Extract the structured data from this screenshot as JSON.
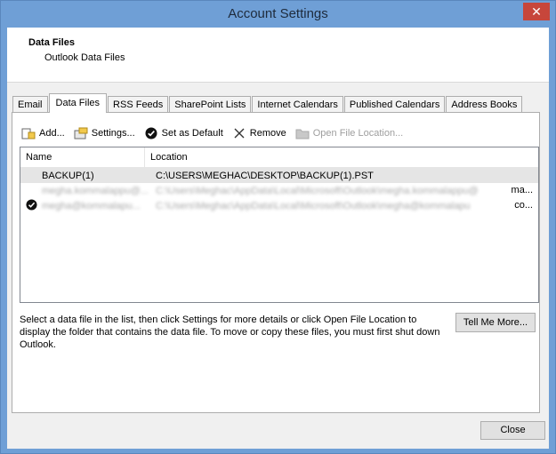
{
  "window": {
    "title": "Account Settings",
    "close_glyph": "✕"
  },
  "header": {
    "title": "Data Files",
    "subtitle": "Outlook Data Files"
  },
  "tabs": [
    {
      "label": "Email"
    },
    {
      "label": "Data Files",
      "active": true
    },
    {
      "label": "RSS Feeds"
    },
    {
      "label": "SharePoint Lists"
    },
    {
      "label": "Internet Calendars"
    },
    {
      "label": "Published Calendars"
    },
    {
      "label": "Address Books"
    }
  ],
  "toolbar": {
    "add_label": "Add...",
    "settings_label": "Settings...",
    "set_default_label": "Set as Default",
    "remove_label": "Remove",
    "open_location_label": "Open File Location..."
  },
  "list": {
    "columns": {
      "name": "Name",
      "location": "Location"
    },
    "rows": [
      {
        "name": "BACKUP(1)",
        "location": "C:\\USERS\\MEGHAC\\DESKTOP\\BACKUP(1).PST"
      },
      {
        "name": "megha.kommalappu@...",
        "location": "C:\\Users\\Meghac\\AppData\\Local\\Microsoft\\Outlook\\megha.kommalappu@",
        "tail": "ma..."
      },
      {
        "name": "megha@kommalapu...",
        "location": "C:\\Users\\Meghac\\AppData\\Local\\Microsoft\\Outlook\\megha@kommalapu",
        "tail": "co...",
        "default": true
      }
    ]
  },
  "description": "Select a data file in the list, then click Settings for more details or click Open File Location to display the folder that contains the data file. To move or copy these files, you must first shut down Outlook.",
  "buttons": {
    "tell_me_more": "Tell Me More...",
    "close": "Close"
  },
  "colors": {
    "titlebar": "#6f9fd6",
    "close_button": "#c7463b",
    "dialog_bg": "#f0f0f0",
    "selected_row": "#e5e5e5"
  }
}
